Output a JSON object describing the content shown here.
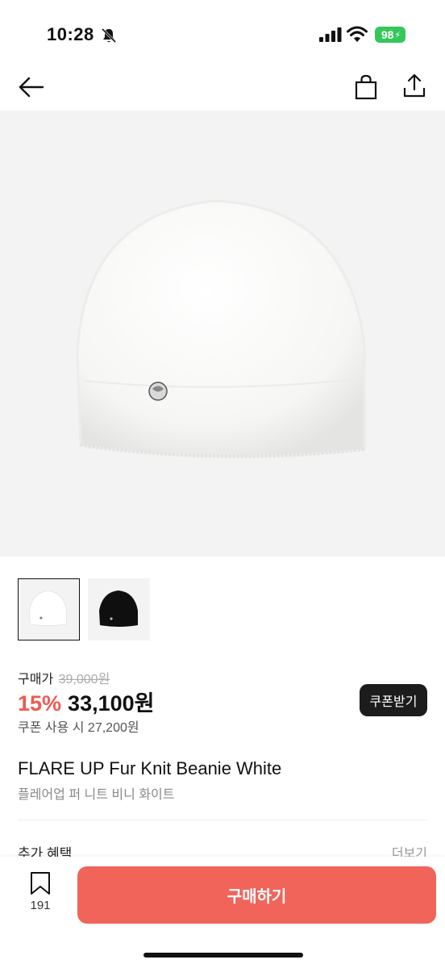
{
  "status_bar": {
    "time": "10:28",
    "battery": "98",
    "battery_color": "#34c759",
    "icons": [
      "bell-slash-icon",
      "signal-icon",
      "wifi-icon",
      "battery-icon"
    ]
  },
  "nav": {
    "icons": [
      "back-arrow-icon",
      "shopping-bag-icon",
      "share-icon"
    ]
  },
  "product": {
    "name": "FLARE UP Fur Knit Beanie White",
    "name_ko": "플레어업 퍼 니트 비니 화이트",
    "thumbnails": [
      {
        "color": "white",
        "selected": true
      },
      {
        "color": "black",
        "selected": false
      }
    ]
  },
  "price": {
    "label": "구매가",
    "original": "39,000원",
    "discount": "15%",
    "sale": "33,100원",
    "coupon_text": "쿠폰 사용 시 27,200원",
    "coupon_button": "쿠폰받기",
    "discount_color": "#ee5a52"
  },
  "benefits": {
    "title": "추가 혜택",
    "more": "더보기"
  },
  "bottom_bar": {
    "wishlist_count": "191",
    "buy_label": "구매하기",
    "buy_color": "#f0645a"
  }
}
